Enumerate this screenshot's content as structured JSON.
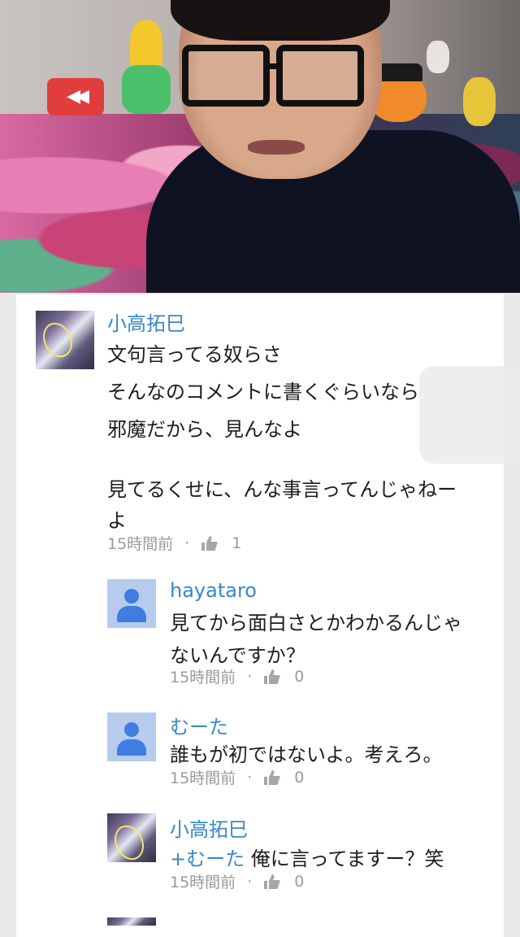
{
  "video": {
    "rewind_glyph": "◀◀"
  },
  "comments": [
    {
      "author": "小高拓巳",
      "avatar": "photo",
      "lines": [
        "文句言ってる奴らさ",
        "そんなのコメントに書くぐらいなら",
        "邪魔だから、見んなよ",
        "",
        "見てるくせに、んな事言ってんじゃねー",
        "よ"
      ],
      "time": "15時間前",
      "likes": "1"
    },
    {
      "author": "hayataro",
      "avatar": "default",
      "lines": [
        "見てから面白さとかわかるんじゃ",
        "ないんですか？"
      ],
      "time": "15時間前",
      "likes": "0"
    },
    {
      "author": "むーた",
      "avatar": "default",
      "lines": [
        "誰もが初ではないよ。考えろ。"
      ],
      "time": "15時間前",
      "likes": "0"
    },
    {
      "author": "小高拓巳",
      "avatar": "photo",
      "mention": "+むーた",
      "lines": [
        "俺に言ってますー？笑"
      ],
      "time": "15時間前",
      "likes": "0"
    }
  ],
  "meta_separator": "·",
  "icons": {
    "like": "thumbs-up-icon",
    "rewind": "rewind-icon",
    "default_avatar": "person-icon"
  },
  "colors": {
    "author": "#3a87c9",
    "text": "#1d1d1d",
    "meta": "#9a9a9a",
    "default_avatar_bg": "#b7cbee",
    "default_avatar_fg": "#3f7de0"
  }
}
